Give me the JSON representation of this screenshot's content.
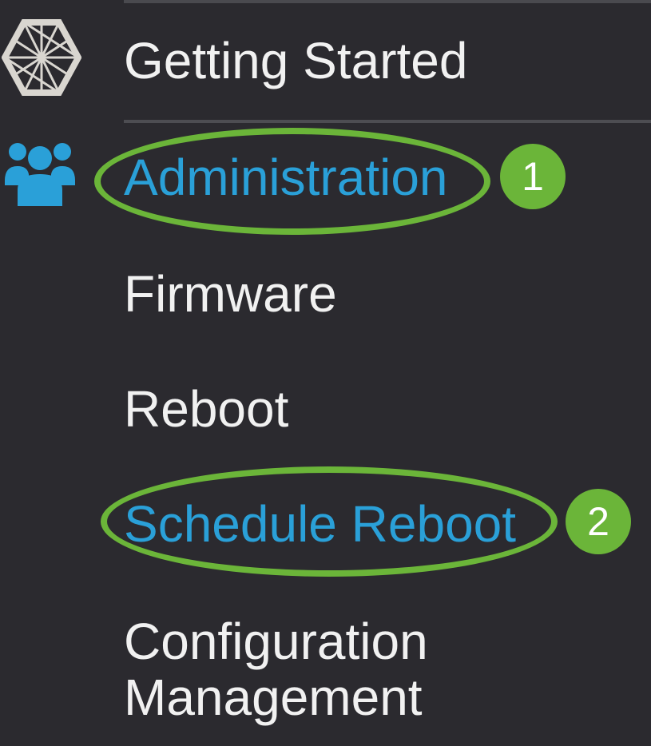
{
  "colors": {
    "background": "#2b2a2f",
    "text": "#f1f1f1",
    "active_text": "#2aa0d8",
    "highlight": "#6bb539",
    "divider": "#4d4d52"
  },
  "nav": {
    "items": [
      {
        "label": "Getting Started",
        "icon": "getting-started-icon",
        "active": false
      },
      {
        "label": "Administration",
        "icon": "users-group-icon",
        "active": true
      },
      {
        "label": "Firmware",
        "active": false
      },
      {
        "label": "Reboot",
        "active": false
      },
      {
        "label": "Schedule Reboot",
        "active": true
      },
      {
        "label_line1": "Configuration",
        "label_line2": "Management",
        "active": false
      }
    ]
  },
  "annotations": {
    "step1": "1",
    "step2": "2"
  }
}
